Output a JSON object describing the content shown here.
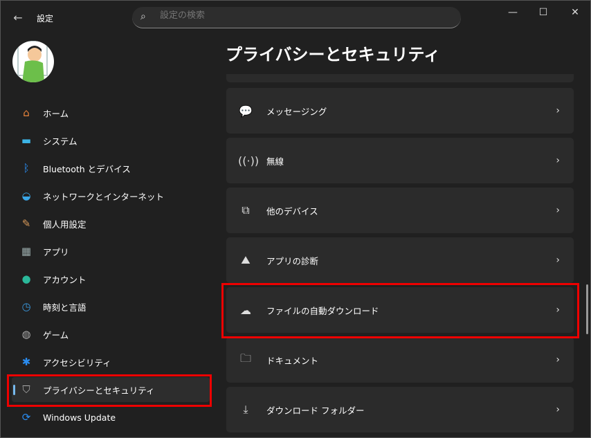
{
  "header": {
    "back": "←",
    "app_title": "設定",
    "search_placeholder": "設定の検索",
    "minimize": "—",
    "maximize": "☐",
    "close": "✕"
  },
  "sidebar": {
    "items": [
      {
        "label": "ホーム",
        "icon": "home-icon",
        "glyph": "⌂",
        "color": "#e8833a"
      },
      {
        "label": "システム",
        "icon": "system-icon",
        "glyph": "▬",
        "color": "#3cb4e6"
      },
      {
        "label": "Bluetooth とデバイス",
        "icon": "bluetooth-icon",
        "glyph": "ᛒ",
        "color": "#2a8cf0"
      },
      {
        "label": "ネットワークとインターネット",
        "icon": "wifi-icon",
        "glyph": "◒",
        "color": "#3aa7e8"
      },
      {
        "label": "個人用設定",
        "icon": "brush-icon",
        "glyph": "✎",
        "color": "#d89a5a"
      },
      {
        "label": "アプリ",
        "icon": "apps-icon",
        "glyph": "▦",
        "color": "#9aa"
      },
      {
        "label": "アカウント",
        "icon": "account-icon",
        "glyph": "●",
        "color": "#2bb89a"
      },
      {
        "label": "時刻と言語",
        "icon": "time-language-icon",
        "glyph": "◷",
        "color": "#3a9ae0"
      },
      {
        "label": "ゲーム",
        "icon": "gamepad-icon",
        "glyph": "◍",
        "color": "#aaa"
      },
      {
        "label": "アクセシビリティ",
        "icon": "accessibility-icon",
        "glyph": "✱",
        "color": "#2a8cf0"
      },
      {
        "label": "プライバシーとセキュリティ",
        "icon": "shield-icon",
        "glyph": "⛉",
        "color": "#aaa"
      },
      {
        "label": "Windows Update",
        "icon": "windows-update-icon",
        "glyph": "⟳",
        "color": "#2a8cf0"
      }
    ]
  },
  "main": {
    "title": "プライバシーとセキュリティ",
    "items": [
      {
        "label": "メッセージング",
        "icon": "message-icon",
        "glyph": "💬"
      },
      {
        "label": "無線",
        "icon": "radio-tower-icon",
        "glyph": "((·))"
      },
      {
        "label": "他のデバイス",
        "icon": "devices-icon",
        "glyph": "⧉"
      },
      {
        "label": "アプリの診断",
        "icon": "diagnostics-icon",
        "glyph": "⛰"
      },
      {
        "label": "ファイルの自動ダウンロード",
        "icon": "cloud-icon",
        "glyph": "☁"
      },
      {
        "label": "ドキュメント",
        "icon": "documents-icon",
        "glyph": "🗀"
      },
      {
        "label": "ダウンロード フォルダー",
        "icon": "download-folder-icon",
        "glyph": "⤓"
      }
    ],
    "chevron": "›"
  }
}
